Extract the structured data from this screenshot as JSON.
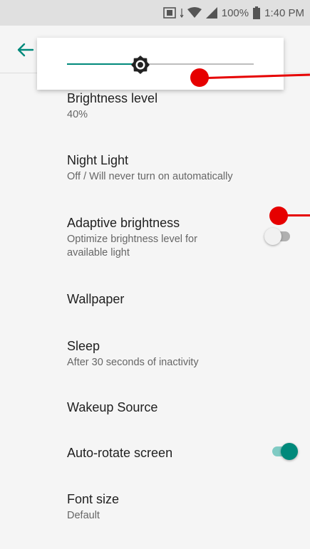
{
  "status_bar": {
    "battery_percent": "100%",
    "time": "1:40 PM",
    "icons": [
      "screenshot-icon",
      "data-arrows-icon",
      "wifi-icon",
      "cell-signal-icon",
      "battery-icon"
    ]
  },
  "brightness_popup": {
    "slider_level": 0.4,
    "thumb_icon": "brightness-icon"
  },
  "settings": [
    {
      "title": "Brightness level",
      "summary": "40%"
    },
    {
      "title": "Night Light",
      "summary": "Off / Will never turn on automatically"
    },
    {
      "title": "Adaptive brightness",
      "summary": "Optimize brightness level for available light",
      "toggle": false
    },
    {
      "title": "Wallpaper",
      "summary": ""
    },
    {
      "title": "Sleep",
      "summary": "After 30 seconds of inactivity"
    },
    {
      "title": "Wakeup Source",
      "summary": ""
    },
    {
      "title": "Auto-rotate screen",
      "summary": "",
      "toggle": true
    },
    {
      "title": "Font size",
      "summary": "Default"
    }
  ],
  "colors": {
    "accent": "#00897b",
    "accent_track": "#80cbc4",
    "toggle_off_thumb": "#f1f1f1",
    "toggle_off_track": "#b0b0b0",
    "annotation": "#e60000"
  }
}
